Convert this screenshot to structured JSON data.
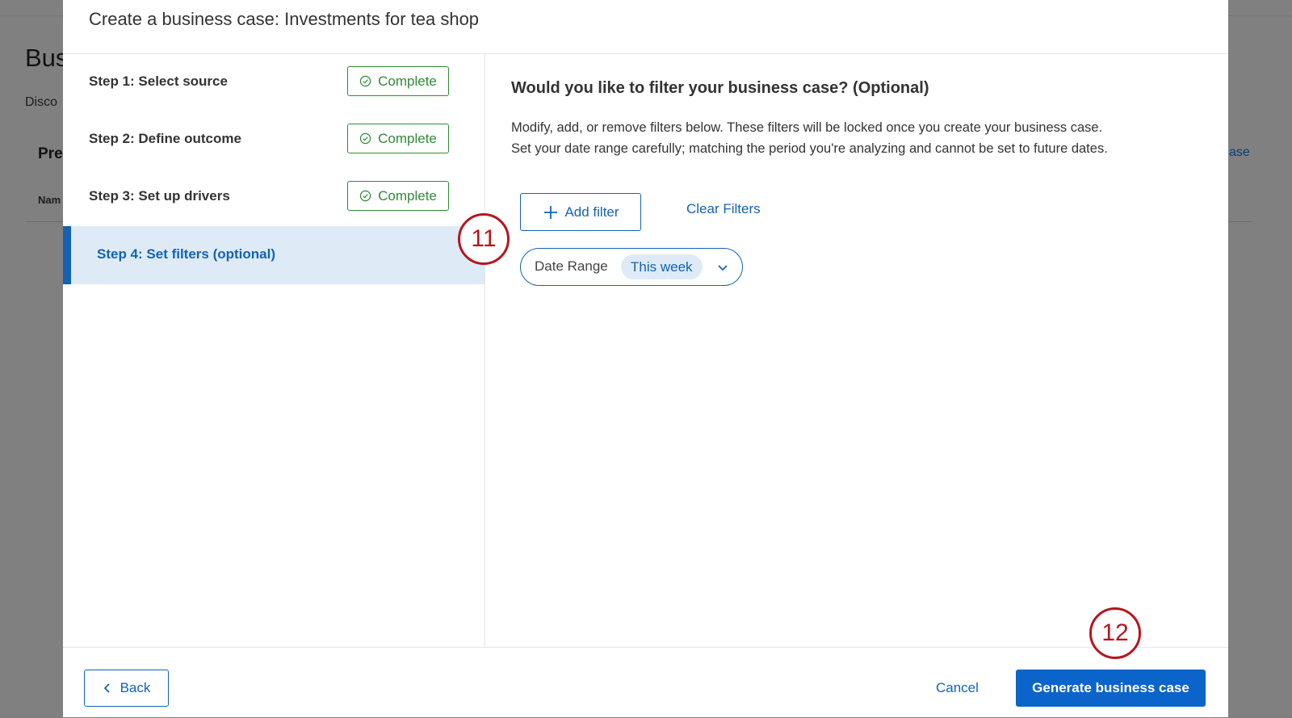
{
  "background": {
    "title_fragment": "Bus",
    "subtitle_fragment": "Disco",
    "section_fragment": "Pre",
    "column_fragment": "Nam",
    "link_fragment": "ase"
  },
  "modal": {
    "title": "Create a business case: Investments for tea shop",
    "steps": [
      {
        "label": "Step 1: Select source",
        "status": "Complete"
      },
      {
        "label": "Step 2: Define outcome",
        "status": "Complete"
      },
      {
        "label": "Step 3: Set up drivers",
        "status": "Complete"
      },
      {
        "label": "Step 4: Set filters (optional)",
        "status": ""
      }
    ],
    "content": {
      "question": "Would you like to filter your business case? (Optional)",
      "description_line1": "Modify, add, or remove filters below. These filters will be locked once you create your business case.",
      "description_line2": "Set your date range carefully; matching the period you're analyzing and cannot be set to future dates.",
      "add_filter_label": "Add filter",
      "clear_filters_label": "Clear Filters",
      "filter_chip": {
        "label": "Date Range",
        "value": "This week"
      }
    },
    "footer": {
      "back_label": "Back",
      "cancel_label": "Cancel",
      "generate_label": "Generate business case"
    }
  },
  "annotations": [
    "11",
    "12"
  ],
  "colors": {
    "accent": "#1462b6",
    "primary_button": "#0b64c9",
    "complete_green": "#2f8a3a",
    "annotation_red": "#b5161e",
    "active_step_bg": "#deebf6"
  }
}
